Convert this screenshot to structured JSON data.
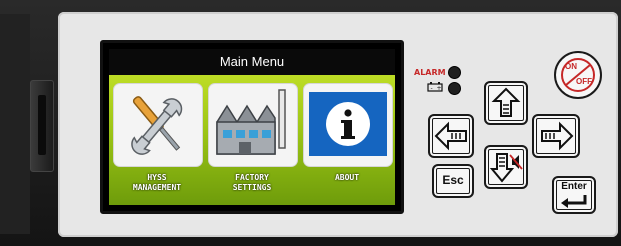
{
  "screen": {
    "title": "Main Menu",
    "tiles": [
      {
        "icon": "wrench-screwdriver-icon",
        "label_line1": "HYSS",
        "label_line2": "MANAGEMENT"
      },
      {
        "icon": "factory-icon",
        "label_line1": "FACTORY",
        "label_line2": "SETTINGS"
      },
      {
        "icon": "info-icon",
        "label_line1": "ABOUT",
        "label_line2": ""
      }
    ]
  },
  "panel": {
    "alarm_label": "ALARM",
    "battery_icon": "battery-icon",
    "buttons": {
      "on_off_top": "ON",
      "on_off_bottom": "OFF",
      "esc": "Esc",
      "enter": "Enter"
    }
  },
  "colors": {
    "screen_green": "#9ac315",
    "alarm_red": "#c62828",
    "info_blue": "#1565c0",
    "onoff_red": "#c62828"
  }
}
